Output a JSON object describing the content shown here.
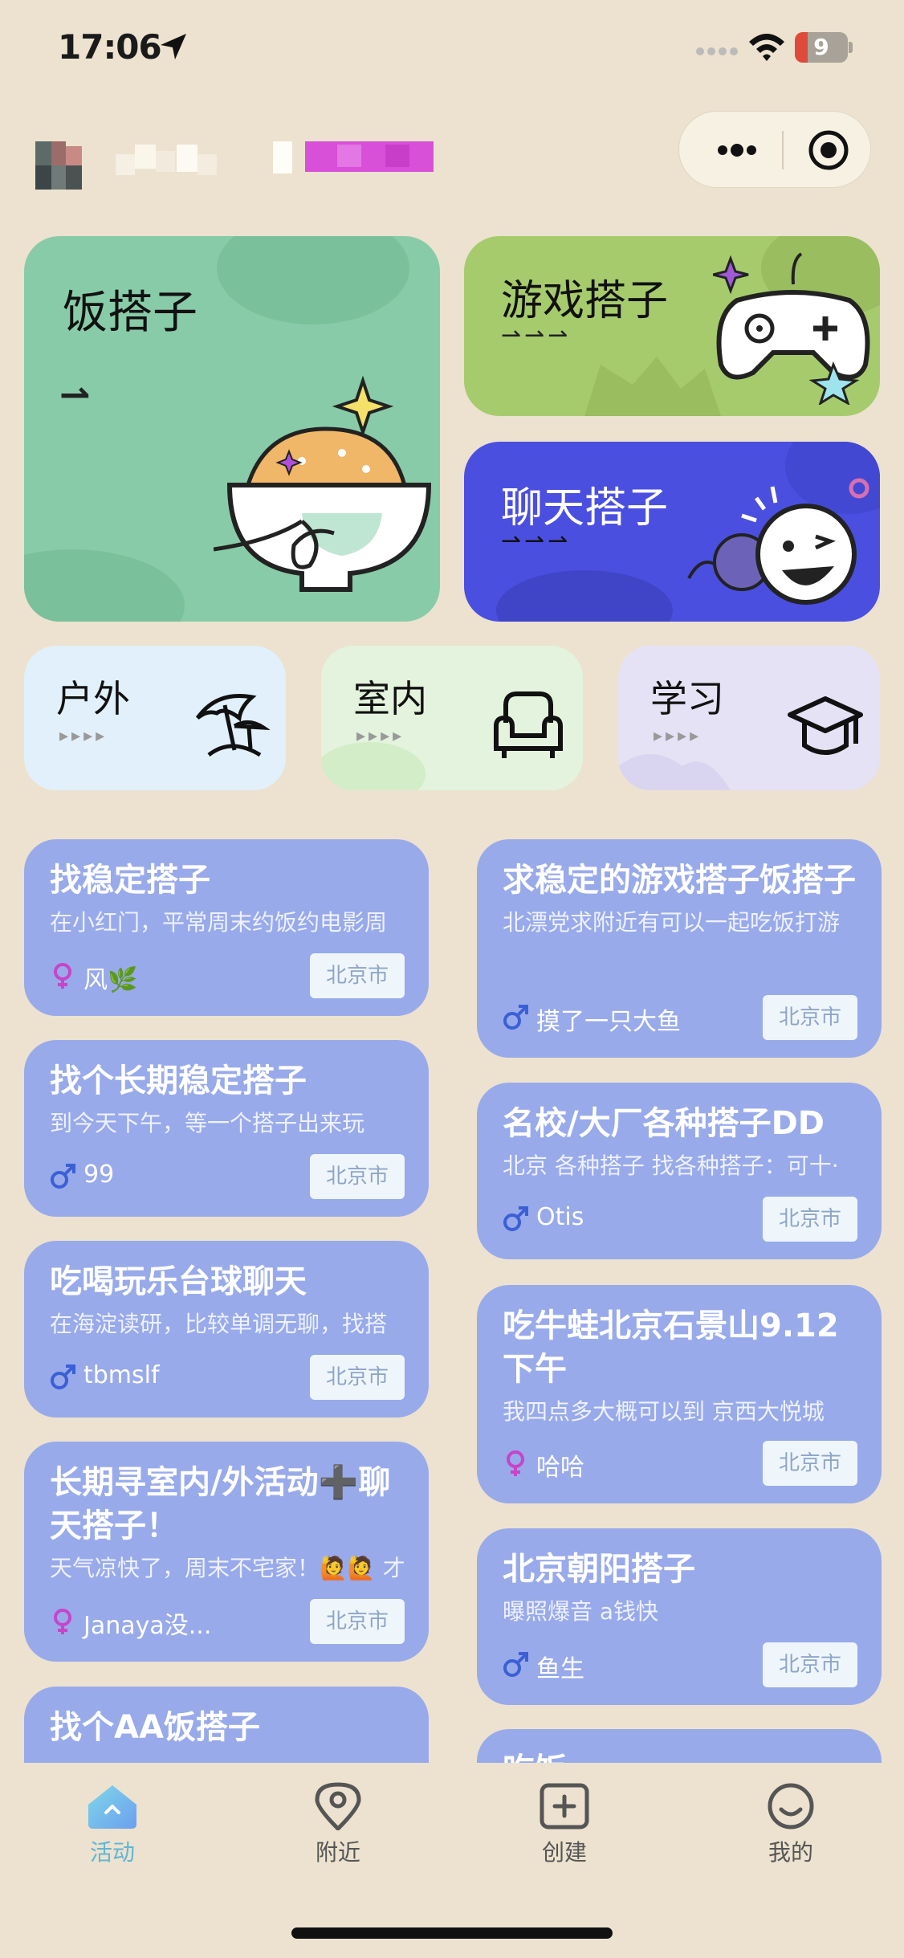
{
  "status_bar": {
    "time": "17:06",
    "battery": "9"
  },
  "categories": {
    "food": {
      "title": "饭搭子",
      "arrow": "⇀"
    },
    "game": {
      "title": "游戏搭子",
      "arrows": "⇀⇀⇀"
    },
    "chat": {
      "title": "聊天搭子",
      "arrows": "⇀⇀⇀"
    }
  },
  "sub_categories": [
    {
      "title": "户外",
      "arrows": "▸▸▸▸",
      "icon": "beach-umbrella-icon"
    },
    {
      "title": "室内",
      "arrows": "▸▸▸▸",
      "icon": "armchair-icon"
    },
    {
      "title": "学习",
      "arrows": "▸▸▸▸",
      "icon": "graduation-cap-icon"
    }
  ],
  "posts_left": [
    {
      "title": "找稳定搭子",
      "desc": "在小红门，平常周末约饭约电影周",
      "gender": "female",
      "author": "风🌿",
      "location": "北京市"
    },
    {
      "title": "找个长期稳定搭子",
      "desc": "到今天下午，等一个搭子出来玩",
      "gender": "male",
      "author": "99",
      "location": "北京市"
    },
    {
      "title": "吃喝玩乐台球聊天",
      "desc": "在海淀读研，比较单调无聊，找搭",
      "gender": "male",
      "author": "tbmslf",
      "location": "北京市"
    },
    {
      "title": "长期寻室内/外活动➕聊天搭子！",
      "desc": "天气凉快了，周末不宅家！🙋🙋 才",
      "gender": "female",
      "author": "Janaya没...",
      "location": "北京市"
    },
    {
      "title": "找个AA饭搭子",
      "desc": "",
      "gender": "",
      "author": "",
      "location": ""
    }
  ],
  "posts_right": [
    {
      "title": "求稳定的游戏搭子饭搭子",
      "desc": "北漂党求附近有可以一起吃饭打游",
      "gender": "male",
      "author": "摸了一只大鱼",
      "location": "北京市"
    },
    {
      "title": "名校/大厂各种搭子DD",
      "desc": "北京 各种搭子 找各种搭子：可十·",
      "gender": "male",
      "author": "Otis",
      "location": "北京市"
    },
    {
      "title": "吃牛蛙北京石景山9.12下午",
      "desc": "我四点多大概可以到 京西大悦城",
      "gender": "female",
      "author": "哈哈",
      "location": "北京市"
    },
    {
      "title": "北京朝阳搭子",
      "desc": "曝照爆音 a钱快",
      "gender": "male",
      "author": "鱼生",
      "location": "北京市"
    },
    {
      "title": "吃饭",
      "desc": "",
      "gender": "",
      "author": "",
      "location": ""
    }
  ],
  "tabbar": {
    "items": [
      {
        "label": "活动",
        "icon": "home-icon",
        "active": true
      },
      {
        "label": "附近",
        "icon": "location-pin-icon",
        "active": false
      },
      {
        "label": "创建",
        "icon": "add-square-icon",
        "active": false
      },
      {
        "label": "我的",
        "icon": "smile-profile-icon",
        "active": false
      }
    ]
  },
  "colors": {
    "background": "#ece2cf",
    "food_card": "#88cba8",
    "game_card": "#a6cb6d",
    "chat_card": "#4a4fe0",
    "post_card": "#98aaea",
    "active_tab": "#5fb6d6",
    "female": "#c844c8",
    "male": "#3b5fd6"
  }
}
